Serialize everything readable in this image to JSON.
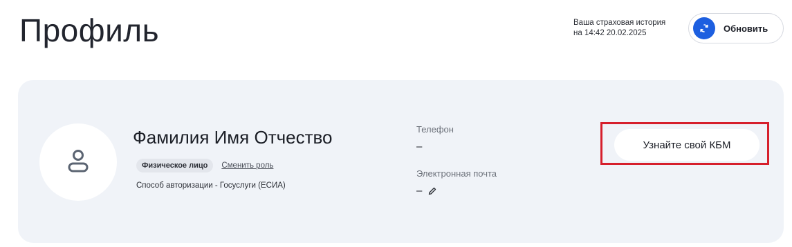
{
  "header": {
    "title": "Профиль",
    "history_line1": "Ваша страховая история",
    "history_line2": "на 14:42 20.02.2025",
    "refresh_label": "Обновить",
    "refresh_icon": "refresh-icon"
  },
  "profile": {
    "avatar_icon": "user-icon",
    "full_name": "Фамилия Имя Отчество",
    "role_badge": "Физическое лицо",
    "change_role_link": "Сменить роль",
    "auth_method": "Способ авторизации - Госуслуги (ЕСИА)",
    "phone_label": "Телефон",
    "phone_value": "–",
    "email_label": "Электронная почта",
    "email_value": "–",
    "email_edit_icon": "pencil-icon",
    "kbm_button": "Узнайте свой КБМ"
  },
  "colors": {
    "accent": "#1d5fe0",
    "card_background": "#f0f3f8",
    "highlight_frame": "#d61f2c"
  }
}
